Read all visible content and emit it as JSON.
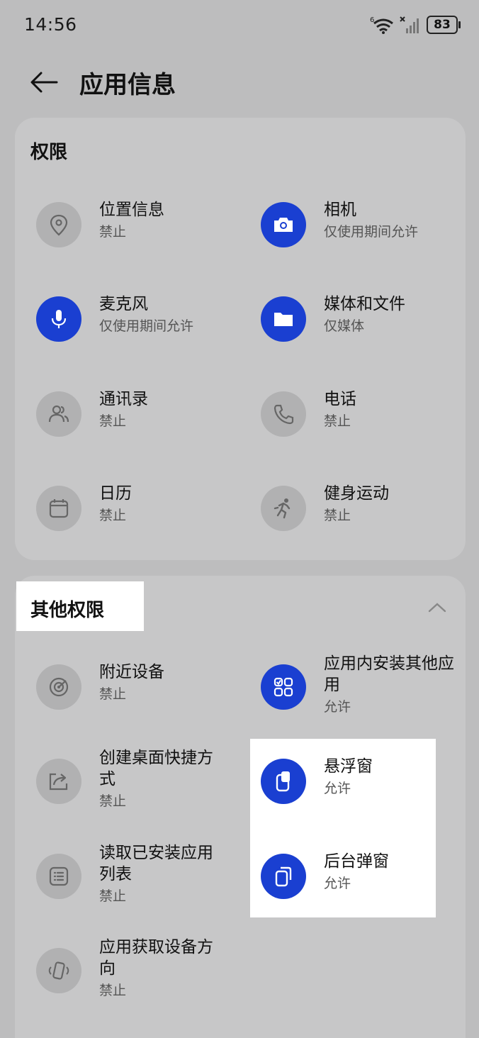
{
  "status_bar": {
    "time": "14:56",
    "wifi_badge": "6",
    "battery": "83"
  },
  "header": {
    "title": "应用信息"
  },
  "permissions": {
    "title": "权限",
    "items": [
      {
        "name": "位置信息",
        "status": "禁止",
        "icon": "location-icon"
      },
      {
        "name": "相机",
        "status": "仅使用期间允许",
        "icon": "camera-icon"
      },
      {
        "name": "麦克风",
        "status": "仅使用期间允许",
        "icon": "microphone-icon"
      },
      {
        "name": "媒体和文件",
        "status": "仅媒体",
        "icon": "folder-icon"
      },
      {
        "name": "通讯录",
        "status": "禁止",
        "icon": "contacts-icon"
      },
      {
        "name": "电话",
        "status": "禁止",
        "icon": "phone-icon"
      },
      {
        "name": "日历",
        "status": "禁止",
        "icon": "calendar-icon"
      },
      {
        "name": "健身运动",
        "status": "禁止",
        "icon": "running-icon"
      }
    ]
  },
  "other_permissions": {
    "title": "其他权限",
    "items": [
      {
        "name": "附近设备",
        "status": "禁止",
        "icon": "nearby-devices-icon"
      },
      {
        "name": "应用内安装其他应用",
        "status": "允许",
        "icon": "install-apps-icon"
      },
      {
        "name": "创建桌面快捷方式",
        "status": "禁止",
        "icon": "shortcut-icon"
      },
      {
        "name": "悬浮窗",
        "status": "允许",
        "icon": "floating-window-icon"
      },
      {
        "name": "读取已安装应用列表",
        "status": "禁止",
        "icon": "app-list-icon"
      },
      {
        "name": "后台弹窗",
        "status": "允许",
        "icon": "background-popup-icon"
      },
      {
        "name": "应用获取设备方向",
        "status": "禁止",
        "icon": "device-orientation-icon"
      }
    ]
  },
  "colors": {
    "accent": "#1a3fd1",
    "background": "#bdbdbe",
    "card": "#c7c7c8"
  }
}
